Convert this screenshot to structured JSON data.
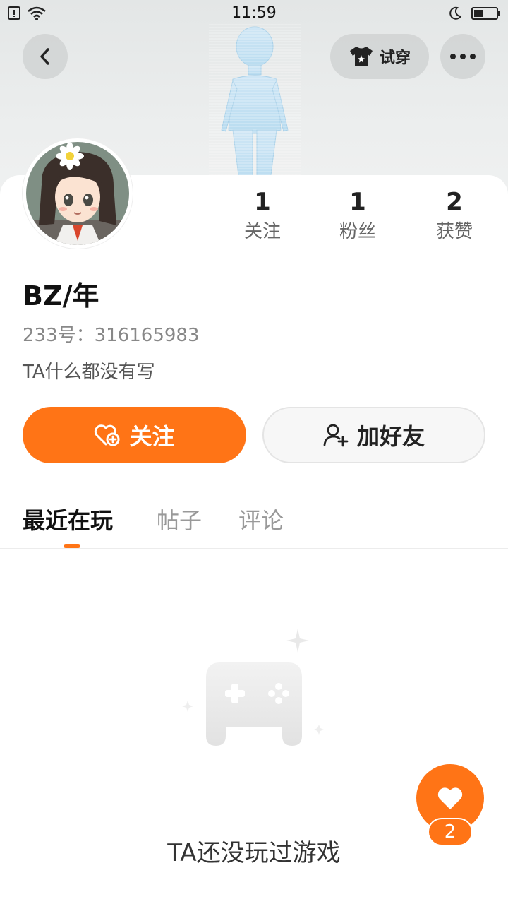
{
  "status_bar": {
    "time": "11:59"
  },
  "header": {
    "try_on_label": "试穿"
  },
  "profile": {
    "nickname": "BZ/年",
    "id_text": "233号：316165983",
    "bio": "TA什么都没有写"
  },
  "stats": [
    {
      "value": "1",
      "label": "关注"
    },
    {
      "value": "1",
      "label": "粉丝"
    },
    {
      "value": "2",
      "label": "获赞"
    }
  ],
  "actions": {
    "follow_label": "关注",
    "add_friend_label": "加好友"
  },
  "tabs": [
    {
      "label": "最近在玩",
      "active": true
    },
    {
      "label": "帖子",
      "active": false
    },
    {
      "label": "评论",
      "active": false
    }
  ],
  "empty_state": {
    "text": "TA还没玩过游戏"
  },
  "like_fab": {
    "count": "2"
  },
  "colors": {
    "accent": "#ff7416"
  }
}
